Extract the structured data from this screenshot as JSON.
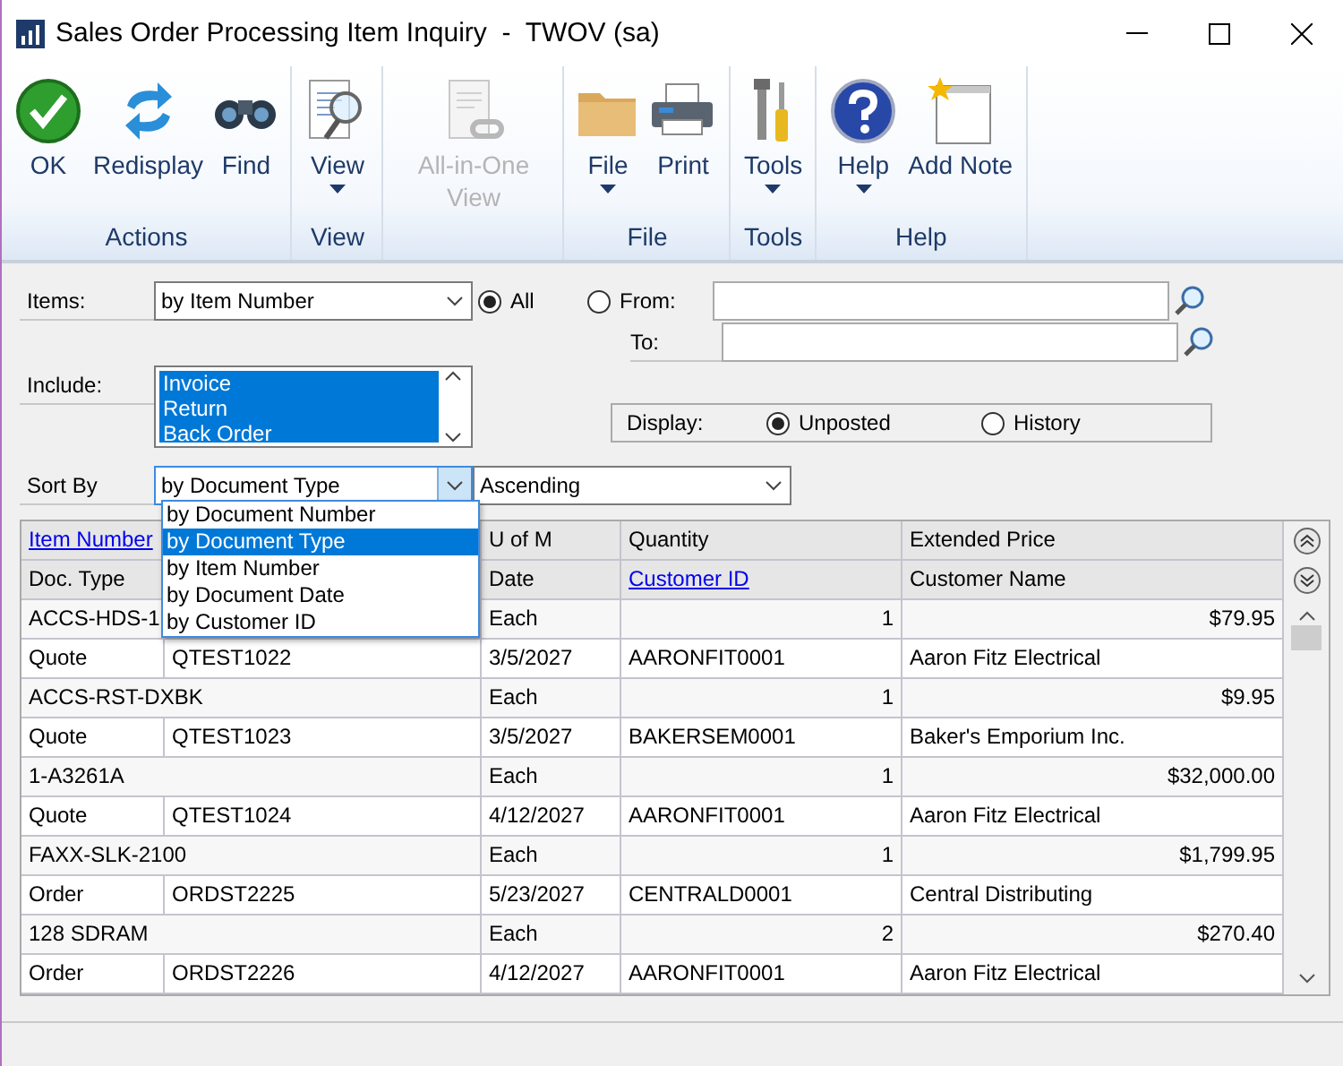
{
  "window": {
    "title": "Sales Order Processing Item Inquiry  -  TWOV (sa)"
  },
  "ribbon": {
    "groups": [
      {
        "label": "Actions",
        "buttons": [
          {
            "label": "OK",
            "disabled": false,
            "dropdown": false
          },
          {
            "label": "Redisplay",
            "disabled": false,
            "dropdown": false
          },
          {
            "label": "Find",
            "disabled": false,
            "dropdown": false
          }
        ]
      },
      {
        "label": "View",
        "buttons": [
          {
            "label": "View",
            "disabled": false,
            "dropdown": true
          }
        ]
      },
      {
        "buttons": [
          {
            "label": "All-in-One View",
            "disabled": true,
            "dropdown": false
          }
        ]
      },
      {
        "label": "File",
        "buttons": [
          {
            "label": "File",
            "disabled": false,
            "dropdown": true
          },
          {
            "label": "Print",
            "disabled": false,
            "dropdown": false
          }
        ]
      },
      {
        "label": "Tools",
        "buttons": [
          {
            "label": "Tools",
            "disabled": false,
            "dropdown": true
          }
        ]
      },
      {
        "label": "Help",
        "buttons": [
          {
            "label": "Help",
            "disabled": false,
            "dropdown": true
          },
          {
            "label": "Add Note",
            "disabled": false,
            "dropdown": false
          }
        ]
      }
    ]
  },
  "form": {
    "items": {
      "label": "Items:",
      "value": "by Item Number"
    },
    "range": [
      {
        "label": "All",
        "selected": true
      },
      {
        "label": "From:",
        "selected": false
      }
    ],
    "to": {
      "label": "To:"
    },
    "include": {
      "label": "Include:",
      "options": [
        {
          "label": "Invoice",
          "selected": true
        },
        {
          "label": "Return",
          "selected": true
        },
        {
          "label": "Back Order",
          "selected": true
        }
      ]
    },
    "display": {
      "label": "Display:",
      "options": [
        {
          "label": "Unposted",
          "selected": true
        },
        {
          "label": "History",
          "selected": false
        }
      ]
    },
    "sort_by": {
      "label": "Sort By",
      "value": "by Document Type",
      "expanded": true,
      "options": [
        {
          "label": "by Document Number",
          "selected": false
        },
        {
          "label": "by Document Type",
          "selected": true
        },
        {
          "label": "by Item Number",
          "selected": false
        },
        {
          "label": "by Document Date",
          "selected": false
        },
        {
          "label": "by Customer ID",
          "selected": false
        }
      ]
    },
    "order": {
      "value": "Ascending"
    }
  },
  "table": {
    "header_rows": [
      {
        "kind": "item",
        "item_number": {
          "label": "Item Number",
          "link": true
        },
        "u_of_m": {
          "label": "U of M",
          "link": false
        },
        "quantity": {
          "label": "Quantity",
          "link": false
        },
        "extended_price": {
          "label": "Extended Price",
          "link": false
        }
      },
      {
        "kind": "document",
        "doc_type": {
          "label": "Doc. Type",
          "link": false
        },
        "date": {
          "label": "Date",
          "link": false
        },
        "customer_id": {
          "label": "Customer ID",
          "link": true
        },
        "customer_name": {
          "label": "Customer Name",
          "link": false
        }
      }
    ],
    "rows": [
      {
        "kind": "item",
        "item_number": "ACCS-HDS-1",
        "u_of_m": "Each",
        "quantity": "1",
        "extended_price": "$79.95"
      },
      {
        "kind": "document",
        "doc_type": "Quote",
        "doc_number": "QTEST1022",
        "date": "3/5/2027",
        "customer_id": "AARONFIT0001",
        "customer_name": "Aaron Fitz Electrical"
      },
      {
        "kind": "item",
        "item_number": "ACCS-RST-DXBK",
        "u_of_m": "Each",
        "quantity": "1",
        "extended_price": "$9.95"
      },
      {
        "kind": "document",
        "doc_type": "Quote",
        "doc_number": "QTEST1023",
        "date": "3/5/2027",
        "customer_id": "BAKERSEM0001",
        "customer_name": "Baker's Emporium Inc."
      },
      {
        "kind": "item",
        "item_number": "1-A3261A",
        "u_of_m": "Each",
        "quantity": "1",
        "extended_price": "$32,000.00"
      },
      {
        "kind": "document",
        "doc_type": "Quote",
        "doc_number": "QTEST1024",
        "date": "4/12/2027",
        "customer_id": "AARONFIT0001",
        "customer_name": "Aaron Fitz Electrical"
      },
      {
        "kind": "item",
        "item_number": "FAXX-SLK-2100",
        "u_of_m": "Each",
        "quantity": "1",
        "extended_price": "$1,799.95"
      },
      {
        "kind": "document",
        "doc_type": "Order",
        "doc_number": "ORDST2225",
        "date": "5/23/2027",
        "customer_id": "CENTRALD0001",
        "customer_name": "Central Distributing"
      },
      {
        "kind": "item",
        "item_number": "128 SDRAM",
        "u_of_m": "Each",
        "quantity": "2",
        "extended_price": "$270.40"
      },
      {
        "kind": "document",
        "doc_type": "Order",
        "doc_number": "ORDST2226",
        "date": "4/12/2027",
        "customer_id": "AARONFIT0001",
        "customer_name": "Aaron Fitz Electrical"
      }
    ]
  }
}
